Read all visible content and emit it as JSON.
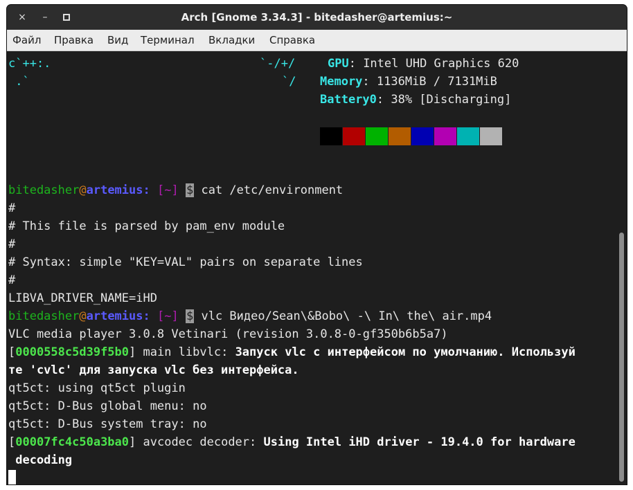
{
  "window": {
    "title": "Arch [Gnome 3.34.3] - bitedasher@artemius:~",
    "close_glyph": "×",
    "minimize_glyph": "–",
    "maximize_glyph": "▫"
  },
  "menu": [
    "Файл",
    "Правка",
    "Вид",
    "Терминал",
    "Вкладки",
    "Справка"
  ],
  "art": [
    {
      "left": "c`++:.",
      "right": "`-/+/"
    },
    {
      "left": " .`",
      "right": "`/"
    }
  ],
  "sysinfo": {
    "gpu_label": "GPU",
    "gpu_value": ": Intel UHD Graphics 620",
    "memory_label": "Memory",
    "memory_value": ": 1136MiB / 7131MiB",
    "battery_label": "Battery0",
    "battery_value": ": 38% [Discharging]"
  },
  "palette": [
    "#000000",
    "#b20000",
    "#00b200",
    "#b25c00",
    "#0000b2",
    "#b200b2",
    "#00b2b2",
    "#b2b2b2"
  ],
  "prompt": {
    "user": "bitedasher",
    "at": "@",
    "host": "artemius",
    "colon": ":",
    "dir": "[~]",
    "dollar": "$"
  },
  "commands": {
    "cmd1": "cat /etc/environment",
    "cmd2": "vlc Видео/Sean\\&Bobo\\ -\\ In\\ the\\ air.mp4"
  },
  "environment_lines": [
    "#",
    "# This file is parsed by pam_env module",
    "#",
    "# Syntax: simple \"KEY=VAL\" pairs on separate lines",
    "#",
    "LIBVA_DRIVER_NAME=iHD"
  ],
  "vlc_output": {
    "version": "VLC media player 3.0.8 Vetinari (revision 3.0.8-0-gf350b6b5a7)",
    "addr1": "0000558c5d39f5b0",
    "module1": " main libvlc: ",
    "msg1a": "Запуск vlc с интерфейсом по умолчанию. Используй",
    "msg1b": "те 'cvlc' для запуска vlc без интерфейса.",
    "qt1": "qt5ct: using qt5ct plugin",
    "qt2": "qt5ct: D-Bus global menu: no",
    "qt3": "qt5ct: D-Bus system tray: no",
    "addr2": "00007fc4c50a3ba0",
    "module2": " avcodec decoder: ",
    "msg2a": "Using Intel iHD driver - 19.4.0 for hardware",
    "msg2b": " decoding"
  },
  "brackets": {
    "open": "[",
    "close": "]"
  }
}
